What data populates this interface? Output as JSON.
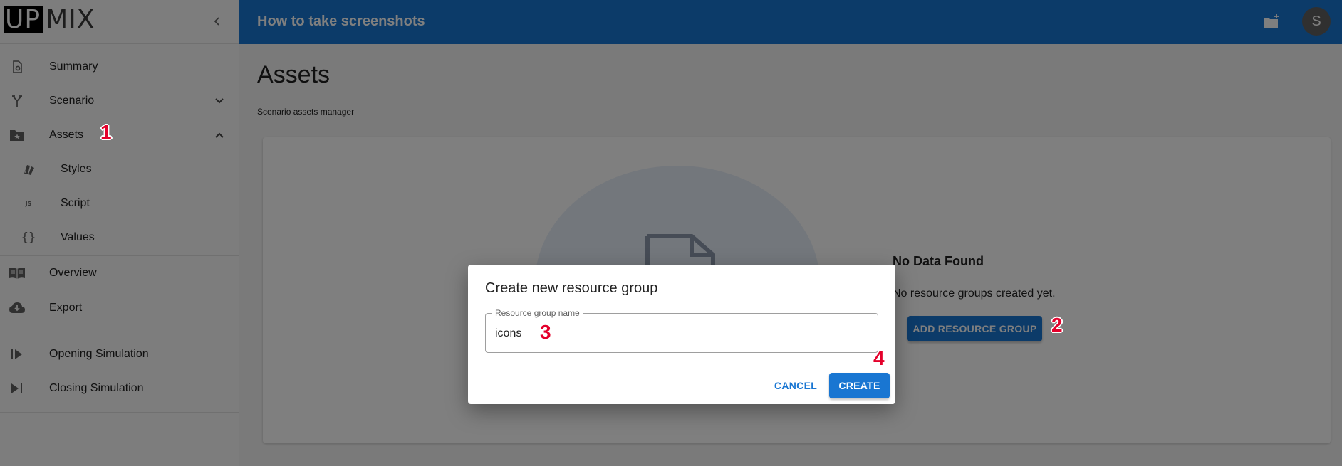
{
  "app": {
    "logo_left": "UP",
    "logo_right": "MIX",
    "project_title": "How to take screenshots",
    "user_initial": "S"
  },
  "sidebar": {
    "items": [
      {
        "label": "Summary",
        "icon": "file-cog-icon"
      },
      {
        "label": "Scenario",
        "icon": "fork-icon",
        "expanded": false
      },
      {
        "label": "Assets",
        "icon": "folder-star-icon",
        "expanded": true
      },
      {
        "label": "Styles",
        "icon": "palette-swatches-icon"
      },
      {
        "label": "Script",
        "icon": "js-icon"
      },
      {
        "label": "Values",
        "icon": "braces-icon"
      },
      {
        "label": "Overview",
        "icon": "book-open-icon"
      },
      {
        "label": "Export",
        "icon": "cloud-download-icon"
      },
      {
        "label": "Opening Simulation",
        "icon": "play-skip-icon"
      },
      {
        "label": "Closing Simulation",
        "icon": "skip-next-icon"
      }
    ]
  },
  "main": {
    "title": "Assets",
    "subtitle": "Scenario assets manager",
    "empty_title": "No Data Found",
    "empty_text": "No resource groups created yet.",
    "add_button": "ADD RESOURCE GROUP"
  },
  "dialog": {
    "title": "Create new resource group",
    "field_label": "Resource group name",
    "field_value": "icons",
    "cancel_label": "CANCEL",
    "create_label": "CREATE"
  },
  "markers": [
    "1",
    "2",
    "3",
    "4"
  ],
  "colors": {
    "primary": "#1976d2",
    "marker": "#e4002b"
  }
}
